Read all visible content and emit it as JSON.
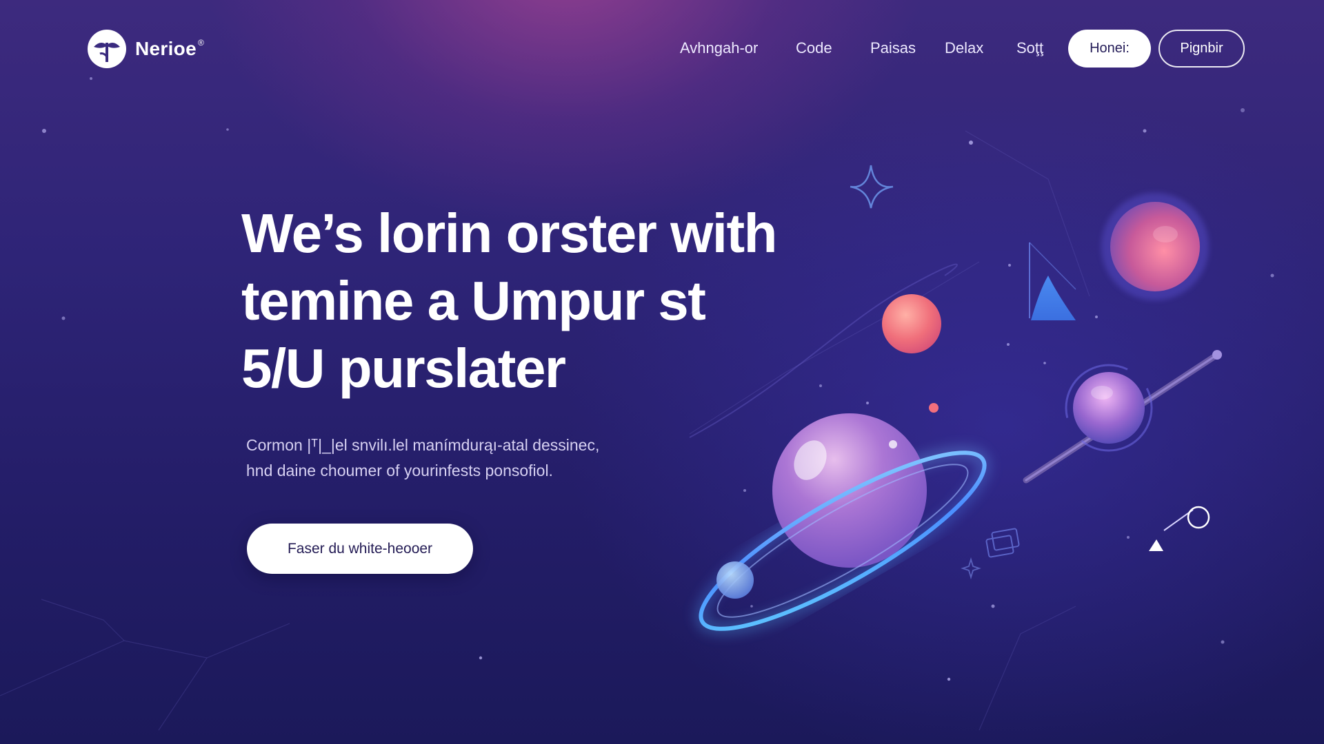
{
  "brand": {
    "name": "Nerioe",
    "mark": "®",
    "logo_icon": "leaf-split-logo"
  },
  "nav": {
    "items": [
      {
        "label": "Avhngah-or"
      },
      {
        "label": "Code"
      },
      {
        "label": "Paisas"
      },
      {
        "label": "Delax"
      },
      {
        "label": "Soţţ"
      }
    ],
    "primary_button": "Honei:",
    "outline_button": "Pignbir"
  },
  "hero": {
    "title_lines": [
      "We’s lorin orster with",
      "temine a Umpur st",
      "5/U purslater"
    ],
    "subtitle_lines": [
      "Cormon |ᵀ|_|el snvilı.lel manímdurąı-atal dessinec,",
      "hnd daine choumer of yourinfests ponsofiol."
    ],
    "cta": "Faser du white-heooer"
  },
  "colors": {
    "background_top": "#3d2a7e",
    "background_bottom": "#1b195a",
    "accent_glow": "#b04696",
    "ring": "#5fc8ff",
    "planet_pink": "#f0707a"
  },
  "illustration": {
    "icons": [
      "sparkle-star-icon",
      "ringed-planet-icon",
      "pink-planet-icon",
      "pink-orb-icon",
      "triangle-card-icon",
      "telescope-icon",
      "small-planet-icon",
      "pointer-arrow-icon",
      "stacked-cards-icon"
    ]
  }
}
